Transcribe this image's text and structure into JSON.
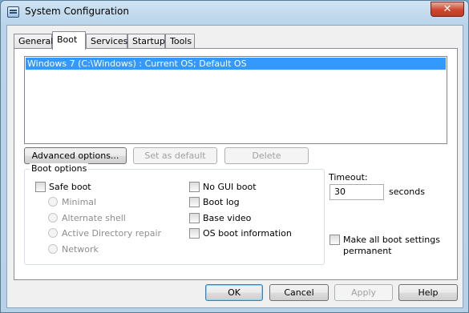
{
  "window": {
    "title": "System Configuration",
    "close_glyph": "✕"
  },
  "tabs": [
    {
      "label": "General"
    },
    {
      "label": "Boot"
    },
    {
      "label": "Services"
    },
    {
      "label": "Startup"
    },
    {
      "label": "Tools"
    }
  ],
  "os_list": {
    "items": [
      "Windows 7 (C:\\Windows) : Current OS; Default OS"
    ]
  },
  "list_buttons": {
    "advanced": "Advanced options...",
    "set_default": "Set as default",
    "delete": "Delete"
  },
  "boot_options": {
    "label": "Boot options",
    "safe_boot": "Safe boot",
    "radios": [
      "Minimal",
      "Alternate shell",
      "Active Directory repair",
      "Network"
    ],
    "right_checks": [
      "No GUI boot",
      "Boot log",
      "Base video",
      "OS boot information"
    ]
  },
  "timeout": {
    "label": "Timeout:",
    "value": "30",
    "unit": "seconds"
  },
  "make_permanent": {
    "line1": "Make all boot settings",
    "line2": "permanent"
  },
  "dialog_buttons": {
    "ok": "OK",
    "cancel": "Cancel",
    "apply": "Apply",
    "help": "Help"
  },
  "colors": {
    "selection": "#3399ff",
    "titlebar": "#b9d4ea",
    "close": "#d0462f"
  },
  "icons": {
    "app": "system-config-icon",
    "close": "close-icon"
  }
}
